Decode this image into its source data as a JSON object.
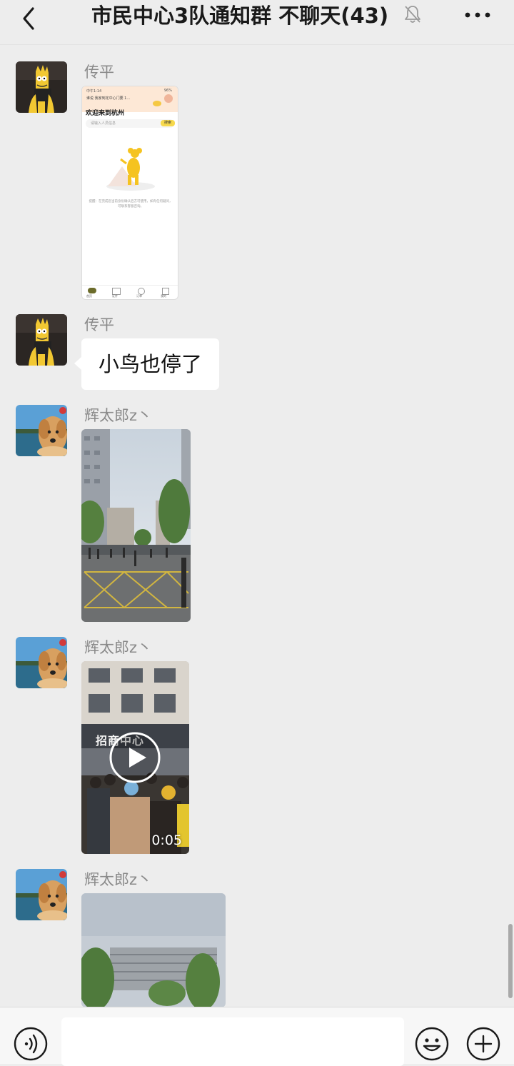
{
  "header": {
    "title": "市民中心3队通知群 不聊天(43)"
  },
  "messages": [
    {
      "sender": "传平",
      "type": "image",
      "screenshot": {
        "status_left": "中午1:14",
        "status_right": "96%",
        "appbar": "谁说 我家到定中心门要 1...",
        "welcome": "欢迎来到杭州",
        "search_hint": "请输入人员信息",
        "search_btn": "搜索",
        "empty_text": "提醒：在完成您当前身份确认后方可使用，如有任何疑问，可联系客服咨询。",
        "tabs": [
          "首页",
          "证件",
          "订单",
          "我的"
        ]
      }
    },
    {
      "sender": "传平",
      "type": "text",
      "text": "小鸟也停了"
    },
    {
      "sender": "辉太郎z丶",
      "type": "image"
    },
    {
      "sender": "辉太郎z丶",
      "type": "video",
      "sign": "招商中心",
      "duration": "0:05"
    },
    {
      "sender": "辉太郎z丶",
      "type": "image"
    }
  ],
  "input": {
    "placeholder": ""
  }
}
